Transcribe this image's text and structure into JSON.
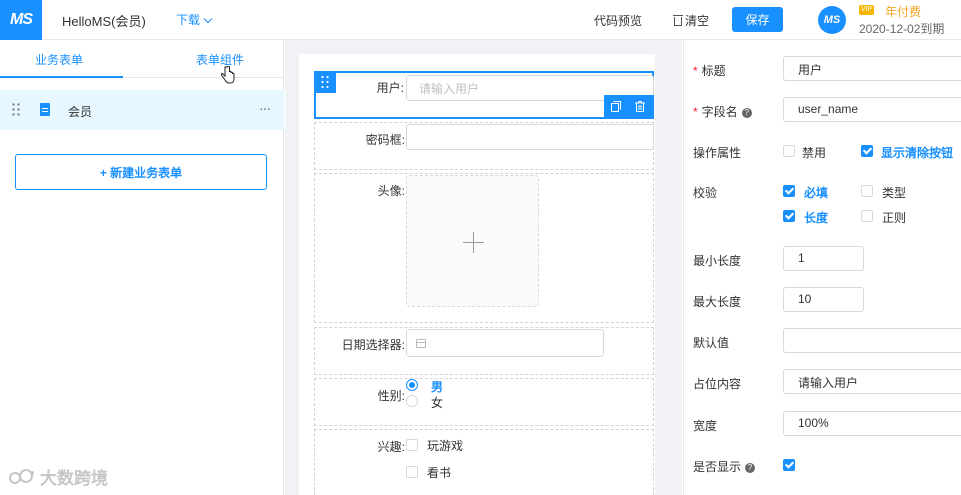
{
  "header": {
    "logo": "MS",
    "app_title": "HelloMS(会员)",
    "download": "下载",
    "code_preview": "代码预览",
    "clear": "清空",
    "save": "保存",
    "avatar": "MS",
    "vip_badge": "VIP",
    "plan": "年付费",
    "expire": "2020-12-02到期"
  },
  "left": {
    "tabs": [
      "业务表单",
      "表单组件"
    ],
    "active_tab": "业务表单",
    "form_items": [
      {
        "name": "会员"
      }
    ],
    "more": "···",
    "new_form": "+ 新建业务表单",
    "watermark": "大数跨境"
  },
  "canvas": {
    "fields": {
      "user": {
        "label": "用户:",
        "placeholder": "请输入用户"
      },
      "password": {
        "label": "密码框:"
      },
      "avatar": {
        "label": "头像:"
      },
      "date": {
        "label": "日期选择器:"
      },
      "gender": {
        "label": "性别:",
        "options": [
          "男",
          "女"
        ],
        "selected": "男"
      },
      "hobby": {
        "label": "兴趣:",
        "options": [
          "玩游戏",
          "看书"
        ]
      }
    }
  },
  "props": {
    "title": {
      "label": "标题",
      "value": "用户"
    },
    "field_name": {
      "label": "字段名",
      "value": "user_name"
    },
    "operation": {
      "label": "操作属性",
      "disabled": "禁用",
      "show_clear": "显示清除按钮"
    },
    "validation": {
      "label": "校验",
      "required": "必填",
      "type": "类型",
      "length": "长度",
      "regex": "正则"
    },
    "min_length": {
      "label": "最小长度",
      "value": "1"
    },
    "max_length": {
      "label": "最大长度",
      "value": "10"
    },
    "default_value": {
      "label": "默认值",
      "value": ""
    },
    "placeholder": {
      "label": "占位内容",
      "value": "请输入用户"
    },
    "width": {
      "label": "宽度",
      "value": "100%"
    },
    "visible": {
      "label": "是否显示"
    }
  },
  "colors": {
    "primary": "#1890ff",
    "required": "#f5222d",
    "vip": "#f5a623"
  }
}
